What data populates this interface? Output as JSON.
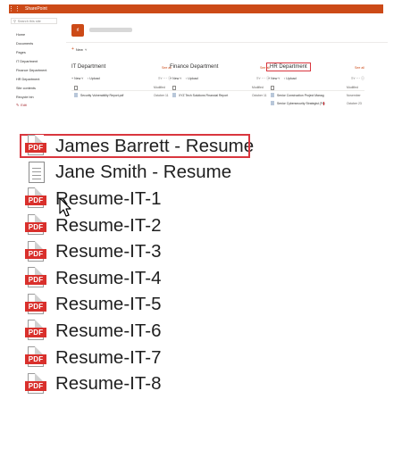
{
  "suitebar": {
    "app_name": "SharePoint"
  },
  "sharepoint": {
    "search_placeholder": "Search this site",
    "nav": [
      "Home",
      "Documents",
      "Pages",
      "IT Department",
      "Finance Department",
      "HR Department",
      "Site contents",
      "Recycle bin"
    ],
    "edit_label": "Edit",
    "site_logo_text": "rl",
    "new_label": "New",
    "libraries": [
      {
        "title": "IT Department",
        "see_all": "See all",
        "toolbar": {
          "new": "New",
          "upload": "Upload"
        },
        "col_modified": "Modified",
        "file": "Security Vulnerability Report.pdf",
        "file_modified": "October 11"
      },
      {
        "title": "Finance Department",
        "see_all": "See all",
        "toolbar": {
          "new": "New",
          "upload": "Upload"
        },
        "col_modified": "Modified",
        "file": "XYZ Tech Solutions Financial Report",
        "file_modified": "October 11"
      },
      {
        "title": "HR Department",
        "see_all": "See all",
        "toolbar": {
          "new": "New",
          "upload": "Upload"
        },
        "col_modified": "Modified",
        "files": [
          {
            "name": "Senior Construction Project Manag",
            "modified": "November"
          },
          {
            "name": "Senior Cybersecurity Strategist (Fin",
            "modified": "October 23"
          }
        ]
      }
    ]
  },
  "file_list": [
    {
      "name": "James Barrett - Resume",
      "icon": "pdf-icon"
    },
    {
      "name": "Jane Smith - Resume",
      "icon": "document-icon"
    },
    {
      "name": "Resume-IT-1",
      "icon": "pdf-icon"
    },
    {
      "name": "Resume-IT-2",
      "icon": "pdf-icon"
    },
    {
      "name": "Resume-IT-3",
      "icon": "pdf-icon"
    },
    {
      "name": "Resume-IT-4",
      "icon": "pdf-icon"
    },
    {
      "name": "Resume-IT-5",
      "icon": "pdf-icon"
    },
    {
      "name": "Resume-IT-6",
      "icon": "pdf-icon"
    },
    {
      "name": "Resume-IT-7",
      "icon": "pdf-icon"
    },
    {
      "name": "Resume-IT-8",
      "icon": "pdf-icon"
    }
  ],
  "pdf_badge": "PDF",
  "colors": {
    "accent": "#cc4a17",
    "highlight": "#d9363e",
    "pdf_red": "#d9302c"
  }
}
